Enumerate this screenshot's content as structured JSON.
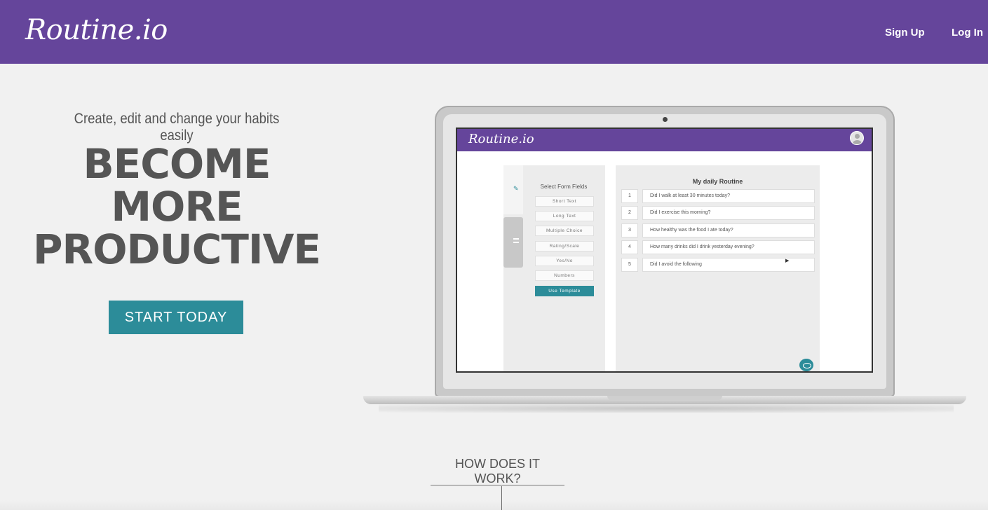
{
  "header": {
    "brand": "Routine.io",
    "nav": {
      "signup": "Sign Up",
      "login": "Log In"
    },
    "color": "#65459b"
  },
  "hero": {
    "tagline": "Create, edit and change your habits easily",
    "headline": [
      "BECOME",
      "MORE",
      "PRODUCTIVE"
    ],
    "cta": "START TODAY",
    "cta_color": "#2c8c99"
  },
  "preview": {
    "brand": "Routine.io",
    "fields_title": "Select Form Fields",
    "fields": [
      "Short Text",
      "Long Text",
      "Multiple Choice",
      "Rating/Scale",
      "Yes/No",
      "Numbers"
    ],
    "use_template": "Use Template",
    "routine_title": "My daily Routine",
    "questions": [
      {
        "num": "1",
        "text": "Did I walk at least 30 minutes today?"
      },
      {
        "num": "2",
        "text": "Did I exercise this morning?"
      },
      {
        "num": "3",
        "text": "How healthy was the food I ate today?"
      },
      {
        "num": "4",
        "text": "How many drinks did I drink yesterday evening?"
      },
      {
        "num": "5",
        "text": "Did I avoid the following"
      }
    ],
    "icons": [
      "pencil-icon",
      "list-icon",
      "avatar-icon",
      "eye-icon"
    ]
  },
  "section": {
    "how": "HOW DOES IT WORK?"
  }
}
